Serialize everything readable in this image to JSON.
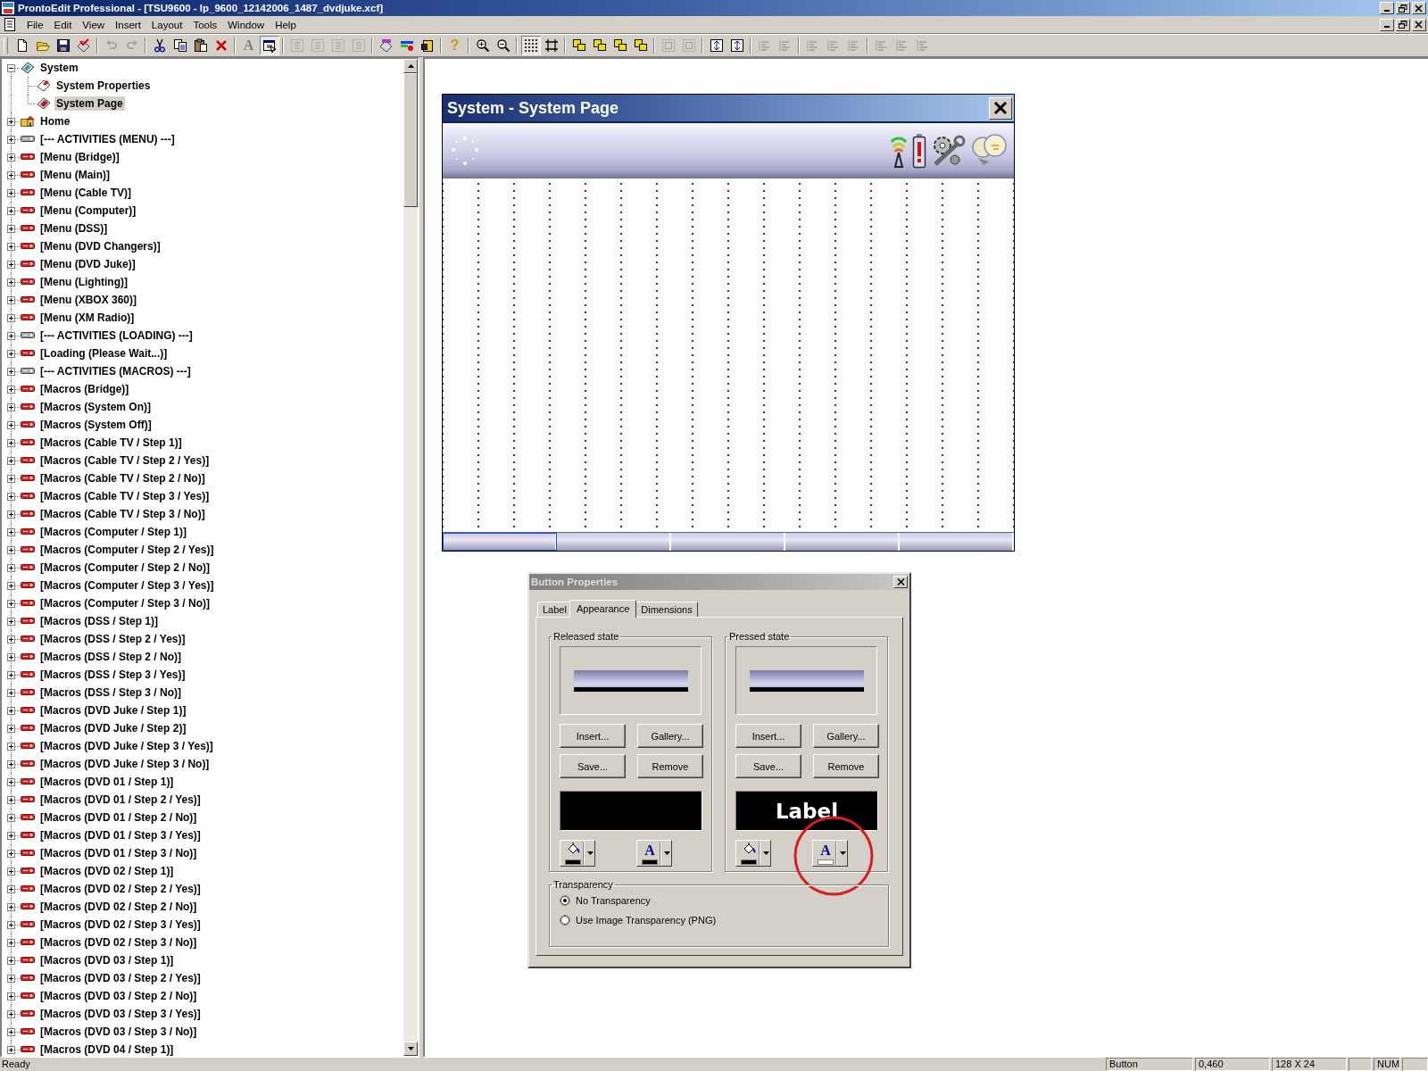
{
  "app": {
    "title": "ProntoEdit Professional - [TSU9600 - lp_9600_12142006_1487_dvdjuke.xcf]"
  },
  "menu": [
    "File",
    "Edit",
    "View",
    "Insert",
    "Layout",
    "Tools",
    "Window",
    "Help"
  ],
  "toolbar": [
    {
      "kind": "new",
      "disabled": false,
      "pressed": false
    },
    {
      "kind": "open",
      "disabled": false,
      "pressed": false
    },
    {
      "kind": "save",
      "disabled": false,
      "pressed": false
    },
    {
      "kind": "validate",
      "disabled": false,
      "pressed": false
    },
    {
      "kind": "separator"
    },
    {
      "kind": "undo",
      "disabled": true,
      "pressed": false
    },
    {
      "kind": "redo",
      "disabled": true,
      "pressed": false
    },
    {
      "kind": "separator"
    },
    {
      "kind": "cut",
      "disabled": false,
      "pressed": false
    },
    {
      "kind": "copy",
      "disabled": false,
      "pressed": false
    },
    {
      "kind": "paste",
      "disabled": false,
      "pressed": false
    },
    {
      "kind": "delete",
      "disabled": false,
      "pressed": false
    },
    {
      "kind": "separator"
    },
    {
      "kind": "text",
      "glyph": "A",
      "disabled": true,
      "pressed": false
    },
    {
      "kind": "properties",
      "disabled": false,
      "pressed": true
    },
    {
      "kind": "separator"
    },
    {
      "kind": "tile",
      "disabled": true,
      "pressed": false
    },
    {
      "kind": "tile",
      "disabled": true,
      "pressed": false
    },
    {
      "kind": "tile",
      "disabled": true,
      "pressed": false
    },
    {
      "kind": "tile",
      "disabled": true,
      "pressed": false
    },
    {
      "kind": "separator"
    },
    {
      "kind": "simulator",
      "disabled": false,
      "pressed": false
    },
    {
      "kind": "colors",
      "disabled": false,
      "pressed": false
    },
    {
      "kind": "export",
      "disabled": false,
      "pressed": false
    },
    {
      "kind": "separator"
    },
    {
      "kind": "help",
      "glyph": "?",
      "disabled": false,
      "pressed": false
    },
    {
      "kind": "separator"
    },
    {
      "kind": "zoom-in",
      "disabled": false,
      "pressed": false
    },
    {
      "kind": "zoom-out",
      "disabled": false,
      "pressed": false
    },
    {
      "kind": "separator"
    },
    {
      "kind": "grid",
      "disabled": false,
      "pressed": true
    },
    {
      "kind": "frame",
      "disabled": false,
      "pressed": false
    },
    {
      "kind": "separator"
    },
    {
      "kind": "arrange",
      "disabled": false,
      "pressed": false
    },
    {
      "kind": "arrange",
      "disabled": false,
      "pressed": false
    },
    {
      "kind": "arrange",
      "disabled": false,
      "pressed": false
    },
    {
      "kind": "arrange",
      "disabled": false,
      "pressed": false
    },
    {
      "kind": "separator"
    },
    {
      "kind": "group",
      "disabled": true,
      "pressed": false
    },
    {
      "kind": "group",
      "disabled": true,
      "pressed": false
    },
    {
      "kind": "separator"
    },
    {
      "kind": "center",
      "disabled": false,
      "pressed": false
    },
    {
      "kind": "center",
      "disabled": false,
      "pressed": false
    },
    {
      "kind": "separator"
    },
    {
      "kind": "align",
      "disabled": true,
      "pressed": false
    },
    {
      "kind": "align",
      "disabled": true,
      "pressed": false
    },
    {
      "kind": "separator"
    },
    {
      "kind": "align",
      "disabled": true,
      "pressed": false
    },
    {
      "kind": "align",
      "disabled": true,
      "pressed": false
    },
    {
      "kind": "align",
      "disabled": true,
      "pressed": false
    },
    {
      "kind": "separator"
    },
    {
      "kind": "align",
      "disabled": true,
      "pressed": false
    },
    {
      "kind": "align",
      "disabled": true,
      "pressed": false
    },
    {
      "kind": "align",
      "disabled": true,
      "pressed": false
    }
  ],
  "tree": [
    {
      "label": "System",
      "kind": "system",
      "expanded": true,
      "selected": false,
      "children": [
        {
          "label": "System Properties",
          "kind": "properties",
          "selected": false
        },
        {
          "label": "System Page",
          "kind": "page",
          "selected": true
        }
      ]
    },
    {
      "label": "Home",
      "kind": "home",
      "expanded": false,
      "selected": false
    },
    {
      "label": "[--- ACTIVITIES (MENU) ---]",
      "kind": "separator",
      "expanded": false,
      "selected": false
    },
    {
      "label": "[Menu (Bridge)]",
      "kind": "activity",
      "expanded": false,
      "selected": false
    },
    {
      "label": "[Menu (Main)]",
      "kind": "activity",
      "expanded": false,
      "selected": false
    },
    {
      "label": "[Menu (Cable TV)]",
      "kind": "activity",
      "expanded": false,
      "selected": false
    },
    {
      "label": "[Menu (Computer)]",
      "kind": "activity",
      "expanded": false,
      "selected": false
    },
    {
      "label": "[Menu (DSS)]",
      "kind": "activity",
      "expanded": false,
      "selected": false
    },
    {
      "label": "[Menu (DVD Changers)]",
      "kind": "activity",
      "expanded": false,
      "selected": false
    },
    {
      "label": "[Menu (DVD Juke)]",
      "kind": "activity",
      "expanded": false,
      "selected": false
    },
    {
      "label": "[Menu (Lighting)]",
      "kind": "activity",
      "expanded": false,
      "selected": false
    },
    {
      "label": "[Menu (XBOX 360)]",
      "kind": "activity",
      "expanded": false,
      "selected": false
    },
    {
      "label": "[Menu (XM Radio)]",
      "kind": "activity",
      "expanded": false,
      "selected": false
    },
    {
      "label": "[--- ACTIVITIES (LOADING) ---]",
      "kind": "separator",
      "expanded": false,
      "selected": false
    },
    {
      "label": "[Loading (Please Wait...)]",
      "kind": "activity",
      "expanded": false,
      "selected": false
    },
    {
      "label": "[--- ACTIVITIES (MACROS) ---]",
      "kind": "separator",
      "expanded": false,
      "selected": false
    },
    {
      "label": "[Macros (Bridge)]",
      "kind": "activity",
      "expanded": false,
      "selected": false
    },
    {
      "label": "[Macros (System On)]",
      "kind": "activity",
      "expanded": false,
      "selected": false
    },
    {
      "label": "[Macros (System Off)]",
      "kind": "activity",
      "expanded": false,
      "selected": false
    },
    {
      "label": "[Macros (Cable TV / Step 1)]",
      "kind": "activity",
      "expanded": false,
      "selected": false
    },
    {
      "label": "[Macros (Cable TV / Step 2 / Yes)]",
      "kind": "activity",
      "expanded": false,
      "selected": false
    },
    {
      "label": "[Macros (Cable TV / Step 2 / No)]",
      "kind": "activity",
      "expanded": false,
      "selected": false
    },
    {
      "label": "[Macros (Cable TV / Step 3 / Yes)]",
      "kind": "activity",
      "expanded": false,
      "selected": false
    },
    {
      "label": "[Macros (Cable TV / Step 3 / No)]",
      "kind": "activity",
      "expanded": false,
      "selected": false
    },
    {
      "label": "[Macros (Computer / Step 1)]",
      "kind": "activity",
      "expanded": false,
      "selected": false
    },
    {
      "label": "[Macros (Computer / Step 2 / Yes)]",
      "kind": "activity",
      "expanded": false,
      "selected": false
    },
    {
      "label": "[Macros (Computer / Step 2 / No)]",
      "kind": "activity",
      "expanded": false,
      "selected": false
    },
    {
      "label": "[Macros (Computer / Step 3 / Yes)]",
      "kind": "activity",
      "expanded": false,
      "selected": false
    },
    {
      "label": "[Macros (Computer / Step 3 / No)]",
      "kind": "activity",
      "expanded": false,
      "selected": false
    },
    {
      "label": "[Macros (DSS / Step 1)]",
      "kind": "activity",
      "expanded": false,
      "selected": false
    },
    {
      "label": "[Macros (DSS / Step 2 / Yes)]",
      "kind": "activity",
      "expanded": false,
      "selected": false
    },
    {
      "label": "[Macros (DSS / Step 2 / No)]",
      "kind": "activity",
      "expanded": false,
      "selected": false
    },
    {
      "label": "[Macros (DSS / Step 3 / Yes)]",
      "kind": "activity",
      "expanded": false,
      "selected": false
    },
    {
      "label": "[Macros (DSS / Step 3 / No)]",
      "kind": "activity",
      "expanded": false,
      "selected": false
    },
    {
      "label": "[Macros (DVD Juke / Step 1)]",
      "kind": "activity",
      "expanded": false,
      "selected": false
    },
    {
      "label": "[Macros (DVD Juke / Step 2)]",
      "kind": "activity",
      "expanded": false,
      "selected": false
    },
    {
      "label": "[Macros (DVD Juke / Step 3 / Yes)]",
      "kind": "activity",
      "expanded": false,
      "selected": false
    },
    {
      "label": "[Macros (DVD Juke / Step 3 / No)]",
      "kind": "activity",
      "expanded": false,
      "selected": false
    },
    {
      "label": "[Macros (DVD 01 / Step 1)]",
      "kind": "activity",
      "expanded": false,
      "selected": false
    },
    {
      "label": "[Macros (DVD 01 / Step 2 / Yes)]",
      "kind": "activity",
      "expanded": false,
      "selected": false
    },
    {
      "label": "[Macros (DVD 01 / Step 2 / No)]",
      "kind": "activity",
      "expanded": false,
      "selected": false
    },
    {
      "label": "[Macros (DVD 01 / Step 3 / Yes)]",
      "kind": "activity",
      "expanded": false,
      "selected": false
    },
    {
      "label": "[Macros (DVD 01 / Step 3 / No)]",
      "kind": "activity",
      "expanded": false,
      "selected": false
    },
    {
      "label": "[Macros (DVD 02 / Step 1)]",
      "kind": "activity",
      "expanded": false,
      "selected": false
    },
    {
      "label": "[Macros (DVD 02 / Step 2 / Yes)]",
      "kind": "activity",
      "expanded": false,
      "selected": false
    },
    {
      "label": "[Macros (DVD 02 / Step 2 / No)]",
      "kind": "activity",
      "expanded": false,
      "selected": false
    },
    {
      "label": "[Macros (DVD 02 / Step 3 / Yes)]",
      "kind": "activity",
      "expanded": false,
      "selected": false
    },
    {
      "label": "[Macros (DVD 02 / Step 3 / No)]",
      "kind": "activity",
      "expanded": false,
      "selected": false
    },
    {
      "label": "[Macros (DVD 03 / Step 1)]",
      "kind": "activity",
      "expanded": false,
      "selected": false
    },
    {
      "label": "[Macros (DVD 03 / Step 2 / Yes)]",
      "kind": "activity",
      "expanded": false,
      "selected": false
    },
    {
      "label": "[Macros (DVD 03 / Step 2 / No)]",
      "kind": "activity",
      "expanded": false,
      "selected": false
    },
    {
      "label": "[Macros (DVD 03 / Step 3 / Yes)]",
      "kind": "activity",
      "expanded": false,
      "selected": false
    },
    {
      "label": "[Macros (DVD 03 / Step 3 / No)]",
      "kind": "activity",
      "expanded": false,
      "selected": false
    },
    {
      "label": "[Macros (DVD 04 / Step 1)]",
      "kind": "activity",
      "expanded": false,
      "selected": false
    }
  ],
  "page_window": {
    "title": "System - System Page",
    "page_tabs": [
      {
        "selected": true
      },
      {
        "selected": false
      },
      {
        "selected": false
      },
      {
        "selected": false
      },
      {
        "selected": false
      }
    ]
  },
  "dialog": {
    "title": "Button Properties",
    "tabs": [
      {
        "label": "Label",
        "selected": false
      },
      {
        "label": "Appearance",
        "selected": true
      },
      {
        "label": "Dimensions",
        "selected": false
      }
    ],
    "states": [
      {
        "title": "Released state",
        "buttons": [
          "Insert...",
          "Gallery...",
          "Save...",
          "Remove"
        ],
        "color_buttons": [
          {
            "kind": "fill",
            "color": "#000000",
            "circled": false
          },
          {
            "kind": "text",
            "glyph": "A",
            "color": "#000000",
            "circled": false
          }
        ]
      },
      {
        "title": "Pressed state",
        "buttons": [
          "Insert...",
          "Gallery...",
          "Save...",
          "Remove"
        ],
        "label_preview": "Label",
        "color_buttons": [
          {
            "kind": "fill",
            "color": "#000000",
            "circled": false
          },
          {
            "kind": "text",
            "glyph": "A",
            "color": "#ffffff",
            "circled": true
          }
        ]
      }
    ],
    "transparency": {
      "title": "Transparency",
      "options": [
        {
          "label": "No Transparency",
          "selected": true
        },
        {
          "label": "Use Image Transparency (PNG)",
          "selected": false
        }
      ]
    }
  },
  "status_bar": {
    "message": "Ready",
    "panels": [
      {
        "kind": "text",
        "text": "Button"
      },
      {
        "kind": "text",
        "text": "0,460"
      },
      {
        "kind": "text",
        "text": "128 X 24"
      },
      {
        "kind": "blank"
      },
      {
        "kind": "text",
        "text": "NUM"
      },
      {
        "kind": "blank"
      }
    ]
  }
}
